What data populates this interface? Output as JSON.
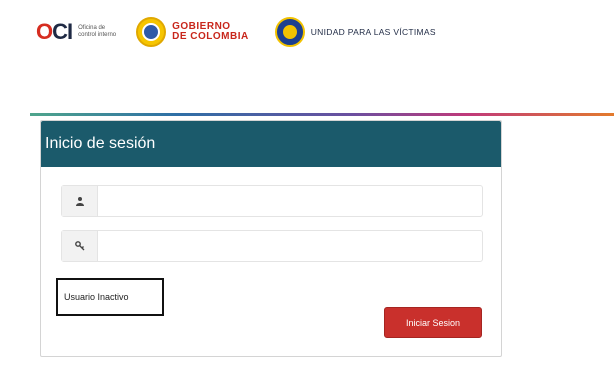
{
  "header": {
    "oci_logo": {
      "mark_o": "O",
      "mark_ci": "CI",
      "text": "Oficina de control interno"
    },
    "gov_logo": {
      "line1": "GOBIERNO",
      "line2": "DE COLOMBIA"
    },
    "uv_logo": {
      "text": "UNIDAD PARA LAS VÍCTIMAS"
    }
  },
  "login": {
    "title": "Inicio de sesión",
    "username": {
      "value": "",
      "icon": "user-icon"
    },
    "password": {
      "value": "",
      "icon": "key-icon"
    },
    "status_message": "Usuario Inactivo",
    "submit_label": "Iniciar Sesion"
  },
  "colors": {
    "panel_header": "#1b5a6b",
    "button": "#c9302c"
  }
}
